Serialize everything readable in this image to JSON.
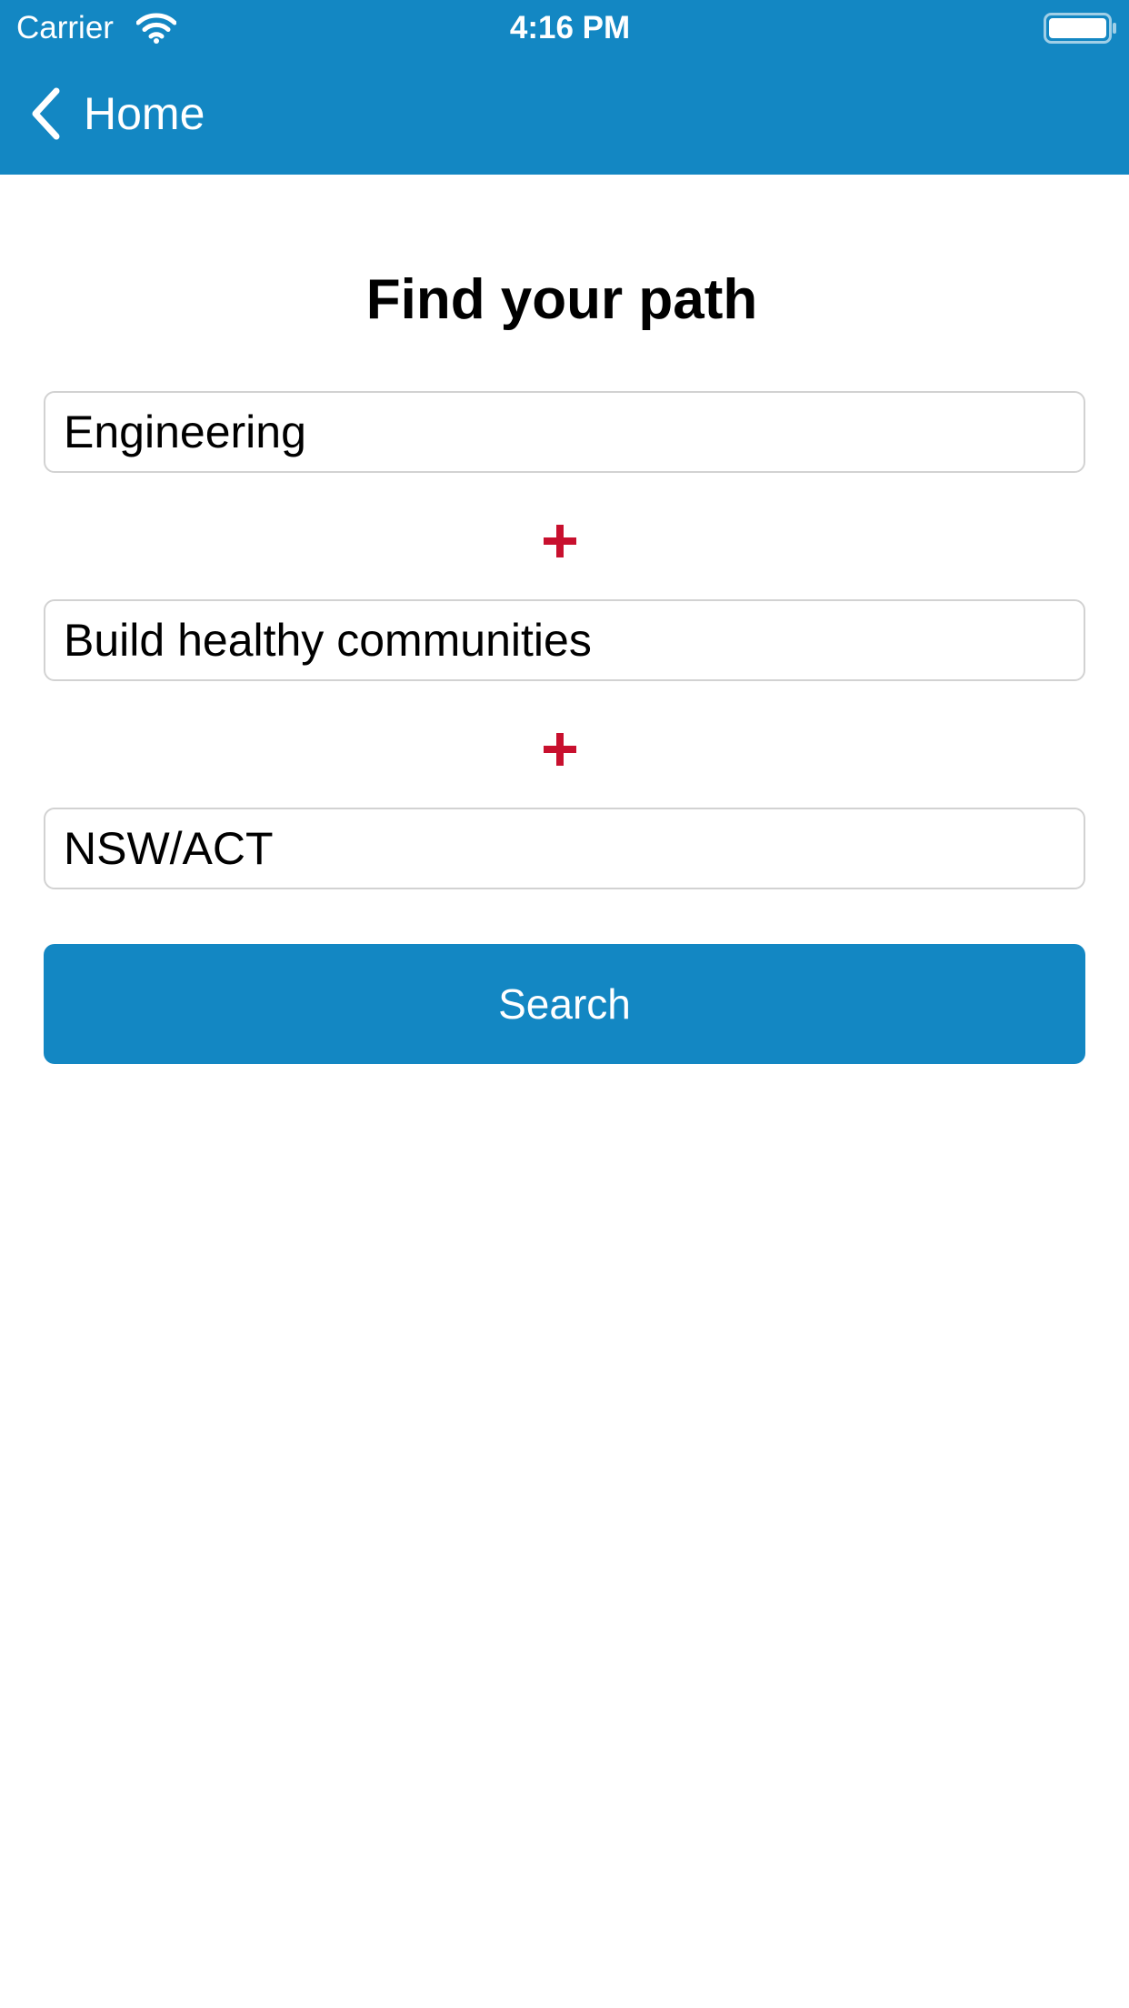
{
  "status_bar": {
    "carrier": "Carrier",
    "time": "4:16 PM",
    "wifi_icon": "wifi-icon",
    "battery_icon": "battery-icon"
  },
  "nav": {
    "back_label": "Home",
    "back_icon": "chevron-left-icon"
  },
  "main": {
    "title": "Find your path",
    "fields": [
      {
        "value": "Engineering"
      },
      {
        "value": "Build healthy communities"
      },
      {
        "value": "NSW/ACT"
      }
    ],
    "separator_icon": "plus-icon",
    "search_label": "Search"
  },
  "colors": {
    "primary": "#1387c3",
    "accent": "#c8102e",
    "background": "#ffffff",
    "field_border": "#d2d2d2"
  }
}
